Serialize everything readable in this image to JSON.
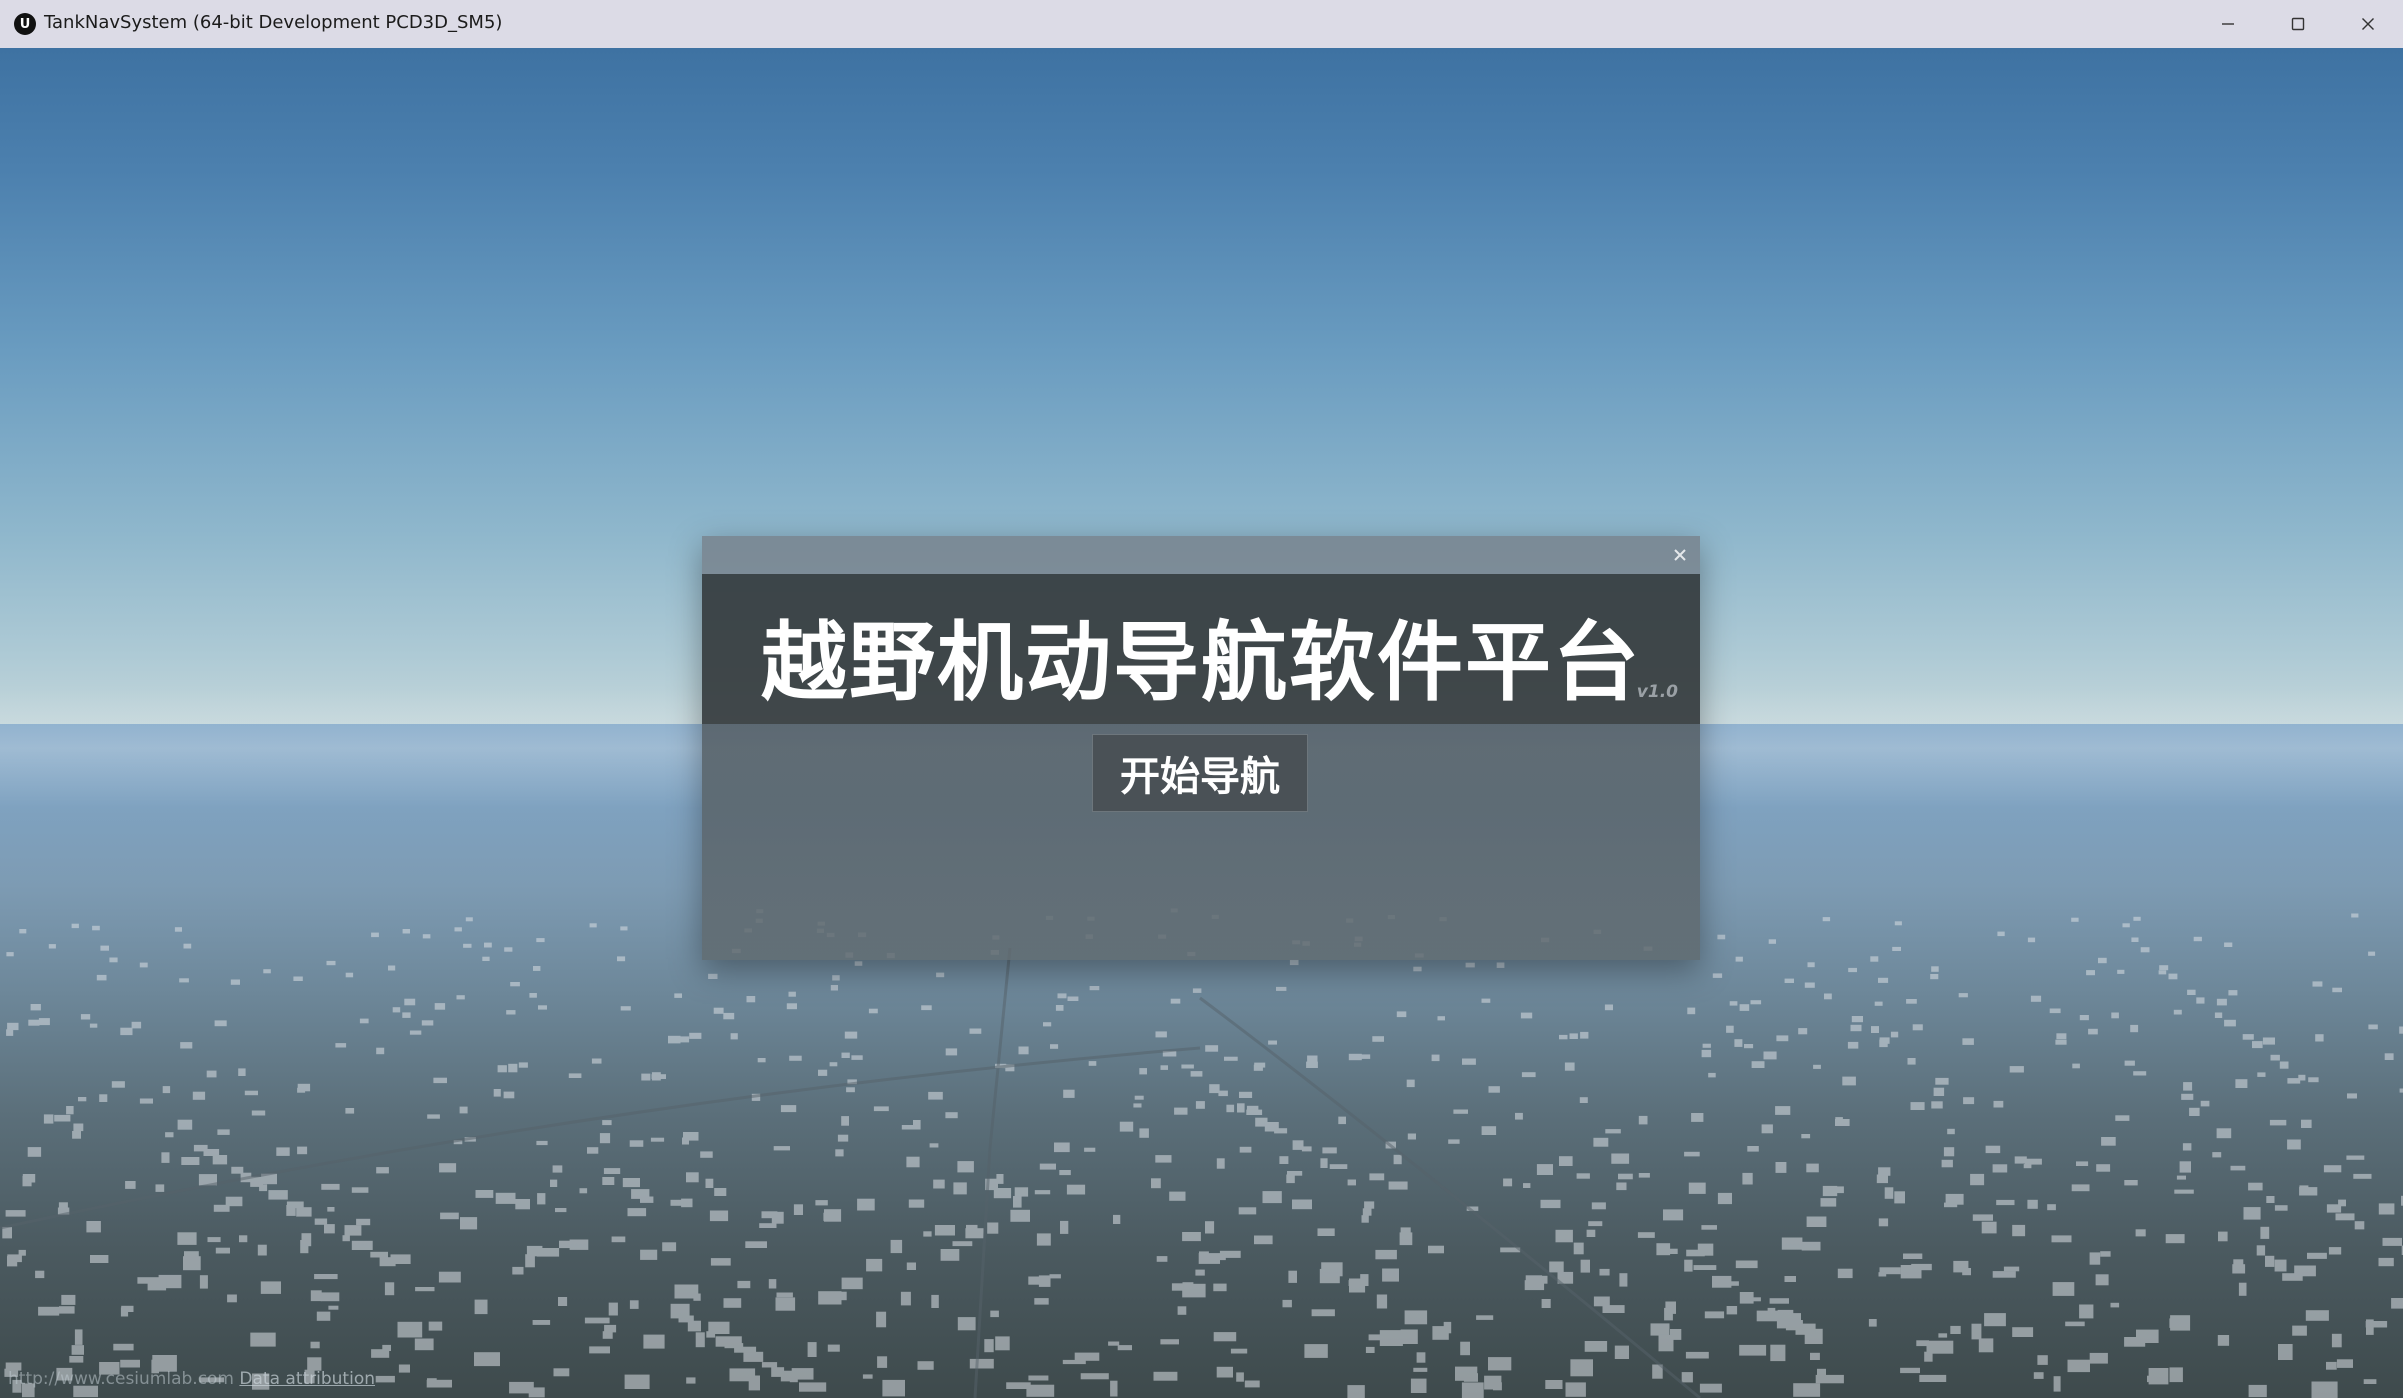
{
  "window": {
    "title": "TankNavSystem (64-bit Development PCD3D_SM5)",
    "app_icon_glyph": "U",
    "icon_names": [
      "unreal-engine-icon",
      "minimize-icon",
      "maximize-icon",
      "close-icon"
    ]
  },
  "dialog": {
    "title": "越野机动导航软件平台",
    "version": "v1.0",
    "start_button_label": "开始导航",
    "close_icon": "close-icon"
  },
  "attribution": {
    "url_text": "http://www.cesiumlab.com",
    "link_text": "Data attribution"
  },
  "colors": {
    "titlebar": "#dcdbe6",
    "dialog_header": "#32373a",
    "dialog_body": "#5f696e",
    "button_bg": "#4a5156",
    "title_text": "#ffffff"
  }
}
